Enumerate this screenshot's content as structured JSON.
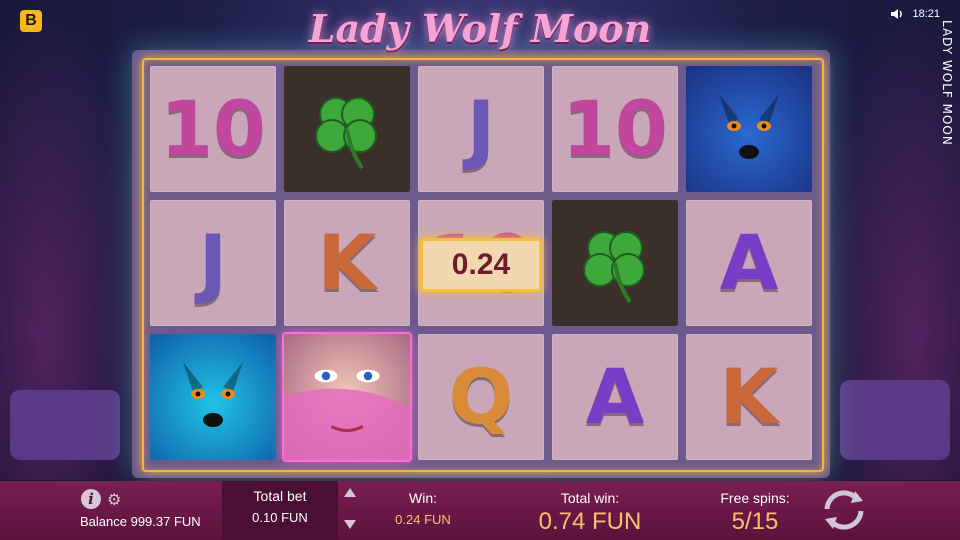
{
  "brand": {
    "badge": "B"
  },
  "status": {
    "time": "18:21",
    "sound_icon": "speaker-icon"
  },
  "side_title": "LADY WOLF MOON",
  "game": {
    "title": "Lady Wolf Moon"
  },
  "reels": [
    [
      {
        "type": "text",
        "value": "10",
        "cls": "s-10"
      },
      {
        "type": "text",
        "value": "J",
        "cls": "s-J"
      },
      {
        "type": "wolf-teal"
      }
    ],
    [
      {
        "type": "clover"
      },
      {
        "type": "text",
        "value": "K",
        "cls": "s-K"
      },
      {
        "type": "lady"
      }
    ],
    [
      {
        "type": "text",
        "value": "J",
        "cls": "s-J"
      },
      {
        "type": "text",
        "value": "10",
        "cls": "s-10"
      },
      {
        "type": "text",
        "value": "Q",
        "cls": "s-Q"
      }
    ],
    [
      {
        "type": "text",
        "value": "10",
        "cls": "s-10"
      },
      {
        "type": "clover"
      },
      {
        "type": "text",
        "value": "A",
        "cls": "s-A"
      }
    ],
    [
      {
        "type": "wolf-blue"
      },
      {
        "type": "text",
        "value": "A",
        "cls": "s-A"
      },
      {
        "type": "text",
        "value": "K",
        "cls": "s-K"
      }
    ]
  ],
  "win_chip": "0.24",
  "bottom_bar": {
    "balance_label": "Balance 999.37 FUN",
    "total_bet_label": "Total bet",
    "total_bet_value": "0.10 FUN",
    "win_label": "Win:",
    "win_value": "0.24 FUN",
    "total_win_label": "Total win:",
    "total_win_value": "0.74 FUN",
    "free_spins_label": "Free spins:",
    "free_spins_value": "5/15"
  },
  "colors": {
    "accent": "#f5c26a",
    "bar": "#7a1f52",
    "frame": "#f2b640"
  }
}
